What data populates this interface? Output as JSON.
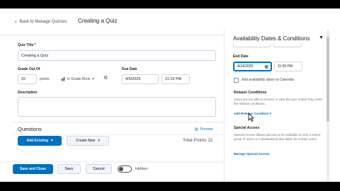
{
  "header": {
    "back_label": "Back to Manage Quizzes",
    "page_title": "Creating a Quiz"
  },
  "form": {
    "quiz_title_label": "Quiz Title *",
    "quiz_title_value": "Creating a Quiz",
    "grade_out_of_label": "Grade Out Of",
    "grade_out_of_value": "22",
    "points_label": "points",
    "grade_item_label": "In Grade Book",
    "due_date_label": "Due Date",
    "due_date_value": "4/5/2025",
    "due_time_value": "11:19 PM",
    "description_label": "Description"
  },
  "questions": {
    "title": "Questions",
    "preview_label": "Preview",
    "add_existing_label": "Add Existing",
    "create_new_label": "Create New",
    "total_points_label": "Total Points 22"
  },
  "footer": {
    "save_close_label": "Save and Close",
    "save_label": "Save",
    "cancel_label": "Cancel",
    "hidden_label": "Hidden"
  },
  "side_panel": {
    "heading": "Availability Dates & Conditions",
    "end_date_label": "End Date",
    "end_date_value": "4/14/2025",
    "end_time_value": "11:59 PM",
    "add_calendar_label": "Add availability dates to Calendar",
    "release_conditions_label": "Release Conditions",
    "release_conditions_text": "Users are not able to access or view the quiz unless they meet the release conditions.",
    "add_release_condition_label": "Add Release Condition",
    "special_access_label": "Special Access",
    "special_access_text": "Special Access allows quizzes to be available to only a select group of users or individualized due dates for certain users.",
    "manage_special_access_label": "Manage Special Access"
  },
  "colors": {
    "primary": "#006fbf",
    "background": "#ffffff",
    "text": "#202122"
  }
}
